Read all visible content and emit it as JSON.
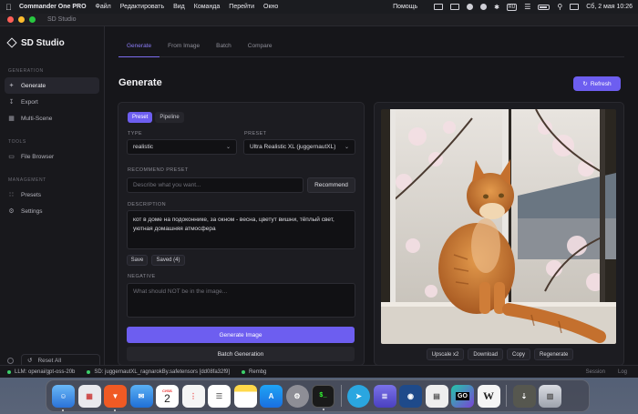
{
  "menubar": {
    "app_name": "Commander One PRO",
    "items": [
      "Файл",
      "Редактировать",
      "Вид",
      "Команда",
      "Перейти",
      "Окно"
    ],
    "help": "Помощь",
    "badge": "RU",
    "datetime": "Сб, 2 мая  10:26"
  },
  "window": {
    "title": "SD Studio"
  },
  "sidebar": {
    "brand": "SD Studio",
    "sections": {
      "generation": "GENERATION",
      "tools": "TOOLS",
      "management": "MANAGEMENT"
    },
    "items": {
      "generate": "Generate",
      "export": "Export",
      "multi_scene": "Multi-Scene",
      "file_browser": "File Browser",
      "presets": "Presets",
      "settings": "Settings"
    },
    "reset_all": "Reset All"
  },
  "tabs": [
    "Generate",
    "From Image",
    "Batch",
    "Compare"
  ],
  "page_title": "Generate",
  "refresh_label": "Refresh",
  "form": {
    "mode": [
      "Preset",
      "Pipeline"
    ],
    "type_label": "TYPE",
    "type_value": "realistic",
    "preset_label": "PRESET",
    "preset_value": "Ultra Realistic XL (juggernautXL)",
    "recommend_label": "RECOMMEND PRESET",
    "recommend_placeholder": "Describe what you want...",
    "recommend_button": "Recommend",
    "description_label": "DESCRIPTION",
    "description_value": "кот в доме на подоконнике, за окном - весна, цветут вишни, тёплый свет, уютная домашняя атмосфера",
    "save_button": "Save",
    "saved_button": "Saved (4)",
    "negative_label": "NEGATIVE",
    "negative_placeholder": "What should NOT be in the image...",
    "generate_button": "Generate Image",
    "batch_button": "Batch Generation"
  },
  "preview": {
    "actions": [
      "Upscale x2",
      "Download",
      "Copy",
      "Regenerate"
    ]
  },
  "status": {
    "llm": "LLM: openai/gpt-oss-20b",
    "sd": "SD: juggernautXL_ragnarokBy.safetensors [dd08fa32f9]",
    "rembg": "Rembg",
    "session": "Session",
    "log": "Log"
  },
  "dock": {
    "calendar_month": "СУББ",
    "calendar_day": "2",
    "go_label": "GO",
    "w_label": "W"
  },
  "colors": {
    "accent": "#6d5ef0",
    "background": "#16161a",
    "panel": "#1c1c21",
    "status_ok": "#3ccf6a"
  }
}
